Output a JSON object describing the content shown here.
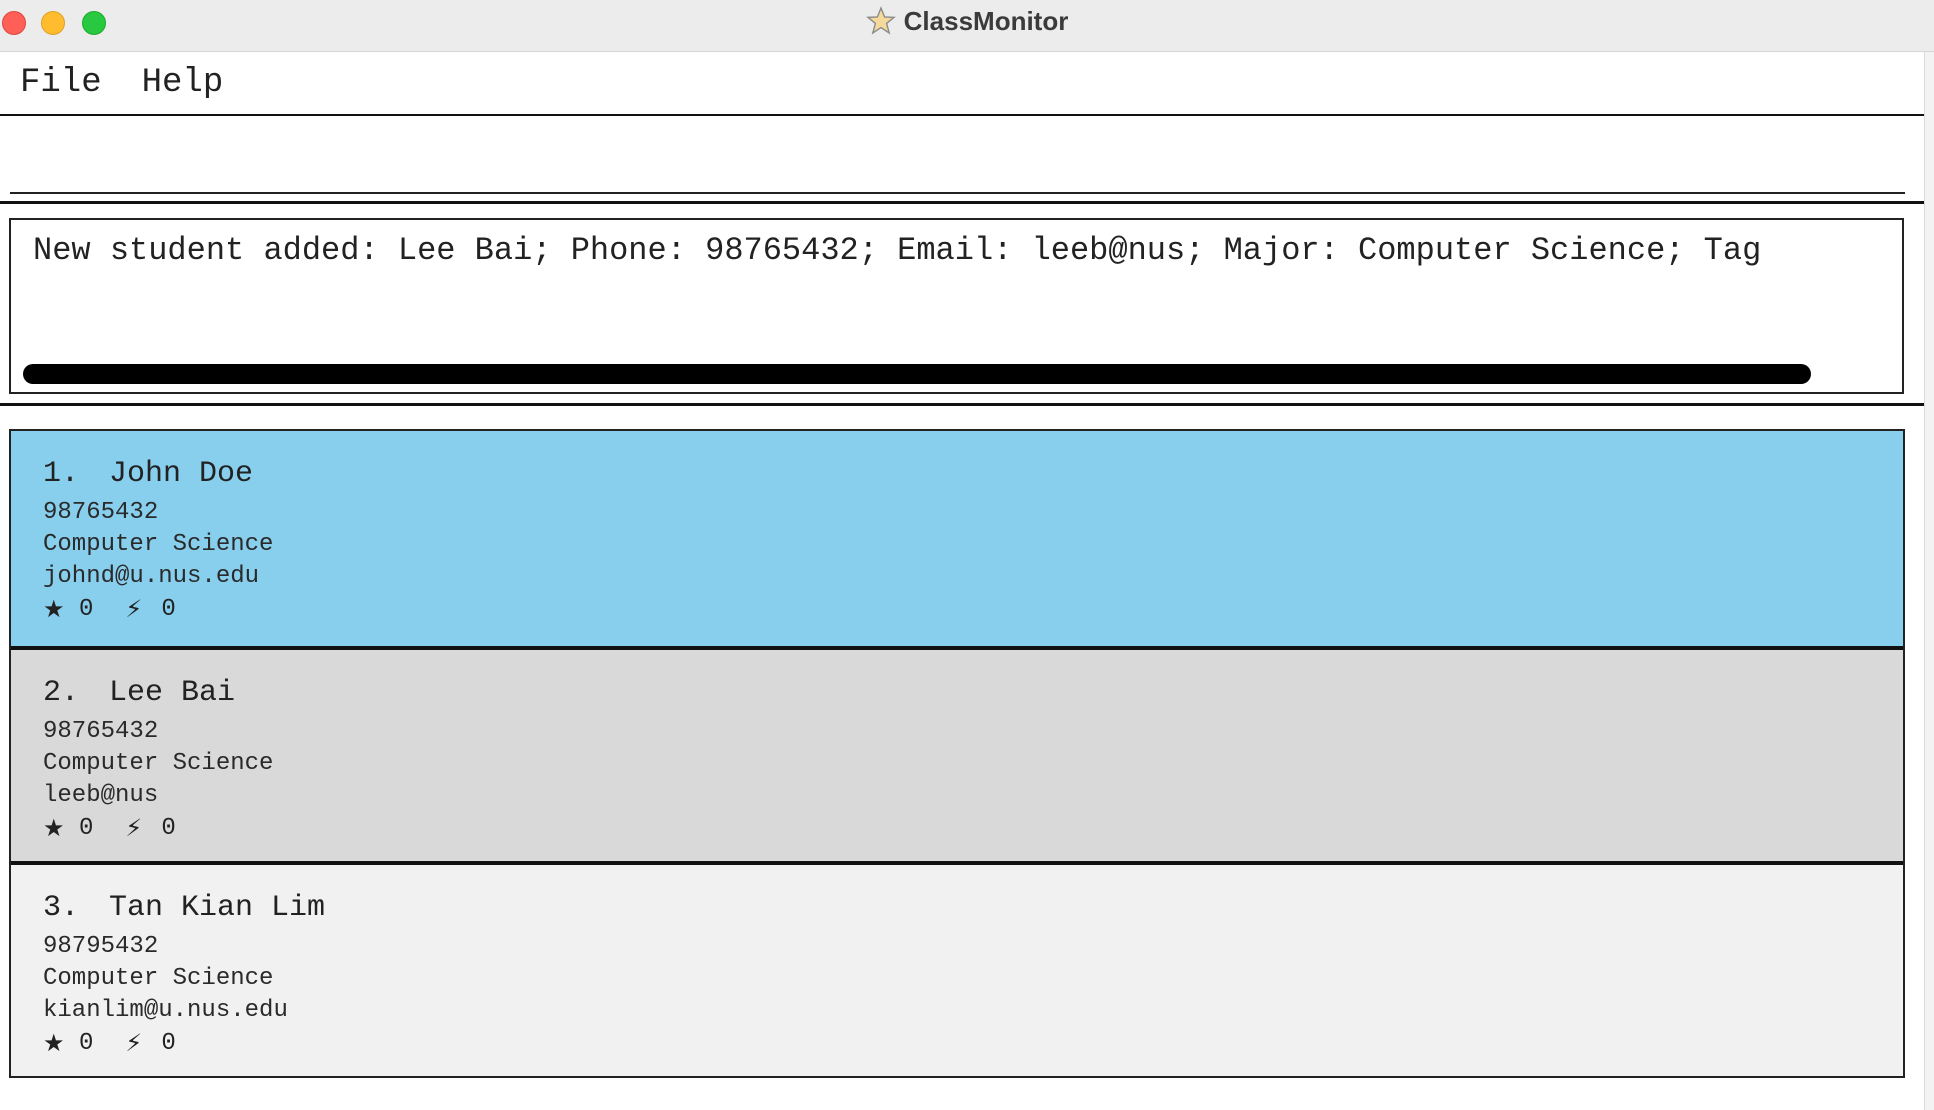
{
  "window": {
    "title": "ClassMonitor",
    "icon": "star-icon"
  },
  "menu": {
    "items": [
      "File",
      "Help"
    ]
  },
  "command": {
    "value": "",
    "placeholder": ""
  },
  "result": {
    "text": "New student added: Lee Bai; Phone: 98765432; Email: leeb@nus; Major: Computer Science; Tag"
  },
  "students": [
    {
      "index": "1.",
      "name": "John Doe",
      "phone": "98765432",
      "major": "Computer Science",
      "email": "johnd@u.nus.edu",
      "star_count": "0",
      "bolt_count": "0",
      "state": "selected"
    },
    {
      "index": "2.",
      "name": "Lee Bai",
      "phone": "98765432",
      "major": "Computer Science",
      "email": "leeb@nus",
      "star_count": "0",
      "bolt_count": "0",
      "state": "alt"
    },
    {
      "index": "3.",
      "name": "Tan Kian Lim",
      "phone": "98795432",
      "major": "Computer Science",
      "email": "kianlim@u.nus.edu",
      "star_count": "0",
      "bolt_count": "0",
      "state": "plain"
    }
  ],
  "icons": {
    "star": "★",
    "bolt": "⚡"
  },
  "colors": {
    "selected": "#88cfee",
    "alt": "#d9d9d9",
    "plain": "#f1f1f1"
  }
}
